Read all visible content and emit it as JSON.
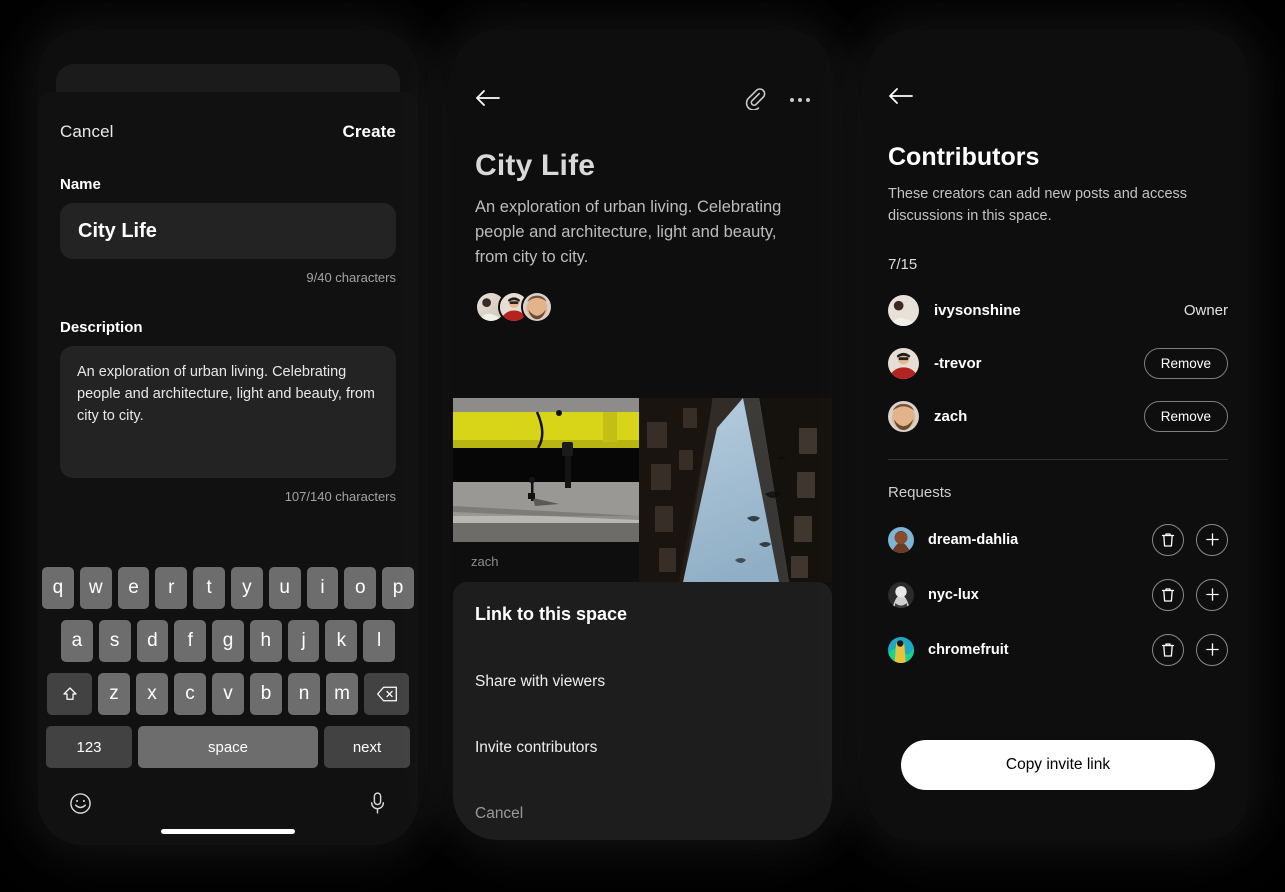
{
  "phone1": {
    "name": "create-space-sheet",
    "cancel_label": "Cancel",
    "create_label": "Create",
    "name_label": "Name",
    "name_value": "City Life",
    "name_placeholder": "Name",
    "name_counter": "9/40 characters",
    "description_label": "Description",
    "description_value": "An exploration of urban living. Celebrating people and architecture, light and beauty, from city to city.",
    "description_placeholder": "Description",
    "description_counter": "107/140 characters",
    "keyboard": {
      "row1": [
        "q",
        "w",
        "e",
        "r",
        "t",
        "y",
        "u",
        "i",
        "o",
        "p"
      ],
      "row2": [
        "a",
        "s",
        "d",
        "f",
        "g",
        "h",
        "j",
        "k",
        "l"
      ],
      "row3": [
        "z",
        "x",
        "c",
        "v",
        "b",
        "n",
        "m"
      ],
      "shift_icon": "shift-icon",
      "backspace_icon": "backspace-icon",
      "numbers_label": "123",
      "space_label": "space",
      "next_label": "next",
      "emoji_icon": "emoji-icon",
      "mic_icon": "microphone-icon"
    }
  },
  "phone2": {
    "name": "space-detail",
    "back_icon": "back-arrow-icon",
    "link_icon": "paperclip-link-icon",
    "more_icon": "more-options-icon",
    "title": "City Life",
    "description": "An exploration of urban living. Celebrating people and architecture, light and beauty, from city to city.",
    "members": [
      "ivysonshine",
      "-trevor",
      "zach"
    ],
    "photos": [
      {
        "caption": "zach",
        "alt": "yellow-bridge-underpass"
      },
      {
        "caption": "",
        "alt": "looking-up-at-buildings"
      }
    ],
    "sheet": {
      "title": "Link to this space",
      "items": [
        {
          "label": "Share with viewers",
          "muted": false
        },
        {
          "label": "Invite contributors",
          "muted": false
        },
        {
          "label": "Cancel",
          "muted": true
        }
      ]
    }
  },
  "phone3": {
    "name": "contributors",
    "back_icon": "back-arrow-icon",
    "title": "Contributors",
    "subtitle": "These creators can add new posts and access discussions in this space.",
    "count": "7/15",
    "contributors": [
      {
        "name": "ivysonshine",
        "role": "Owner",
        "action": ""
      },
      {
        "name": "-trevor",
        "role": "",
        "action": "Remove"
      },
      {
        "name": "zach",
        "role": "",
        "action": "Remove"
      }
    ],
    "requests_label": "Requests",
    "requests": [
      {
        "name": "dream-dahlia",
        "delete_icon": "trash-icon",
        "accept_icon": "plus-icon"
      },
      {
        "name": "nyc-lux",
        "delete_icon": "trash-icon",
        "accept_icon": "plus-icon"
      },
      {
        "name": "chromefruit",
        "delete_icon": "trash-icon",
        "accept_icon": "plus-icon"
      }
    ],
    "cta_label": "Copy invite link"
  },
  "colors": {
    "background": "#000000",
    "surface": "#111111",
    "surface_raised": "#232323",
    "sheet": "#1d1d1d",
    "text_primary": "#ffffff",
    "text_secondary": "#bdbdbd",
    "key": "#6d6d6d",
    "key_mod": "#424242",
    "cta_bg": "#ffffff",
    "cta_text": "#000000"
  }
}
